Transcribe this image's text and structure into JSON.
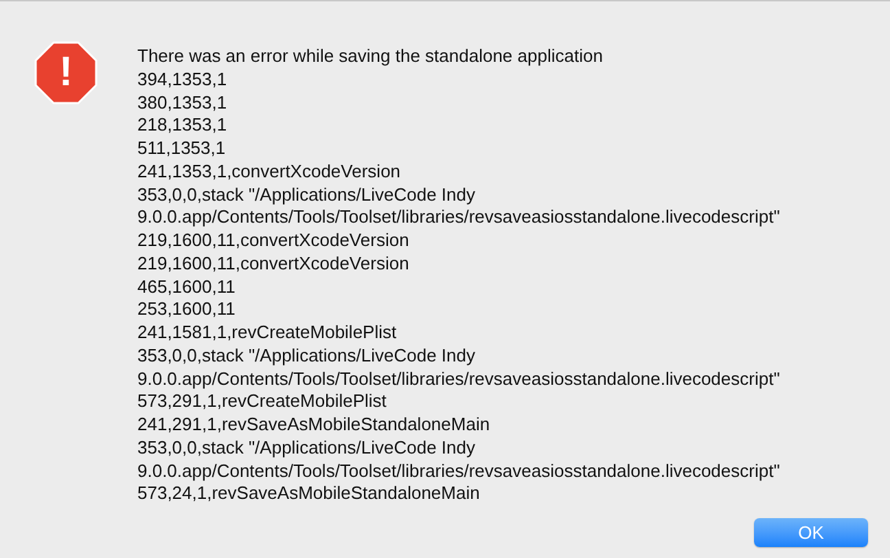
{
  "dialog": {
    "title": "There was an error while saving the standalone application",
    "lines": [
      "394,1353,1",
      "380,1353,1",
      "218,1353,1",
      "511,1353,1",
      "241,1353,1,convertXcodeVersion",
      "353,0,0,stack \"/Applications/LiveCode Indy",
      "9.0.0.app/Contents/Tools/Toolset/libraries/revsaveasiosstandalone.livecodescript\"",
      "219,1600,11,convertXcodeVersion",
      "219,1600,11,convertXcodeVersion",
      "465,1600,11",
      "253,1600,11",
      "241,1581,1,revCreateMobilePlist",
      "353,0,0,stack \"/Applications/LiveCode Indy",
      "9.0.0.app/Contents/Tools/Toolset/libraries/revsaveasiosstandalone.livecodescript\"",
      "573,291,1,revCreateMobilePlist",
      "241,291,1,revSaveAsMobileStandaloneMain",
      "353,0,0,stack \"/Applications/LiveCode Indy",
      "9.0.0.app/Contents/Tools/Toolset/libraries/revsaveasiosstandalone.livecodescript\"",
      "573,24,1,revSaveAsMobileStandaloneMain"
    ],
    "icon": "!",
    "buttons": [
      "OK"
    ]
  }
}
